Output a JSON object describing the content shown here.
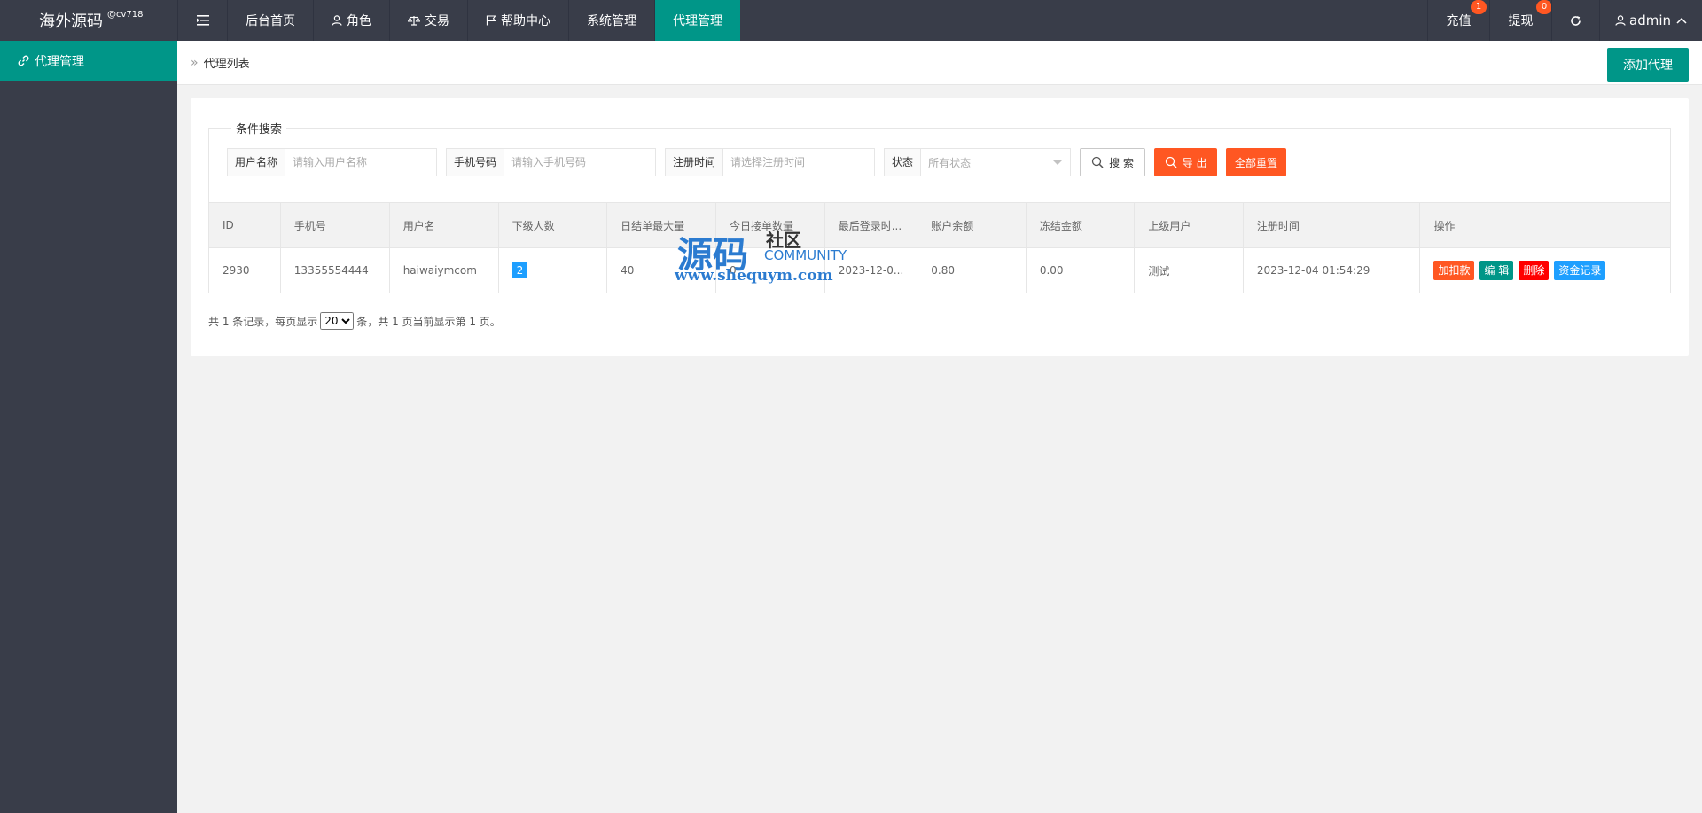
{
  "app": {
    "name": "海外源码",
    "tag": "@cv718"
  },
  "topnav": {
    "items": [
      {
        "label": "后台首页",
        "icon": ""
      },
      {
        "label": "角色",
        "icon": "user-icon"
      },
      {
        "label": "交易",
        "icon": "scale-icon"
      },
      {
        "label": "帮助中心",
        "icon": "flag-icon"
      },
      {
        "label": "系统管理",
        "icon": ""
      },
      {
        "label": "代理管理",
        "icon": ""
      }
    ],
    "active": "代理管理",
    "recharge": {
      "label": "充值",
      "badge": "1"
    },
    "withdraw": {
      "label": "提现",
      "badge": "0"
    },
    "user": "admin"
  },
  "sidebar": {
    "items": [
      {
        "label": "代理管理",
        "icon": "link-icon"
      }
    ]
  },
  "breadcrumb": {
    "label": "代理列表"
  },
  "add_button": "添加代理",
  "search": {
    "legend": "条件搜索",
    "username": {
      "label": "用户名称",
      "placeholder": "请输入用户名称"
    },
    "phone": {
      "label": "手机号码",
      "placeholder": "请输入手机号码"
    },
    "regtime": {
      "label": "注册时间",
      "placeholder": "请选择注册时间"
    },
    "status": {
      "label": "状态",
      "value": "所有状态"
    },
    "search_btn": "搜 索",
    "export_btn": "导 出",
    "reset_btn": "全部重置"
  },
  "table": {
    "headers": [
      "ID",
      "手机号",
      "用户名",
      "下级人数",
      "日结单最大量",
      "今日接单数量",
      "最后登录时...",
      "账户余额",
      "冻结金额",
      "上级用户",
      "注册时间",
      "操作"
    ],
    "rows": [
      {
        "id": "2930",
        "phone": "13355554444",
        "username": "haiwaiymcom",
        "sub_count": "2",
        "daily_max": "40",
        "today_orders": "0",
        "last_login": "2023-12-0...",
        "balance": "0.80",
        "frozen": "0.00",
        "parent": "测试",
        "reg_time": "2023-12-04 01:54:29",
        "actions": [
          "加扣款",
          "编 辑",
          "删除",
          "资金记录"
        ]
      }
    ]
  },
  "pager": {
    "prefix": "共 1 条记录，每页显示",
    "page_size": "20",
    "suffix": "条，共 1 页当前显示第 1 页。"
  },
  "watermark": {
    "big": "源码",
    "small": "社区",
    "community": "COMMUNITY",
    "url": "www.shequym.com"
  },
  "colors": {
    "topbar": "#393d49",
    "primary": "#009688",
    "danger": "#ff5722",
    "info": "#1e9fff",
    "red": "#ff0000"
  }
}
